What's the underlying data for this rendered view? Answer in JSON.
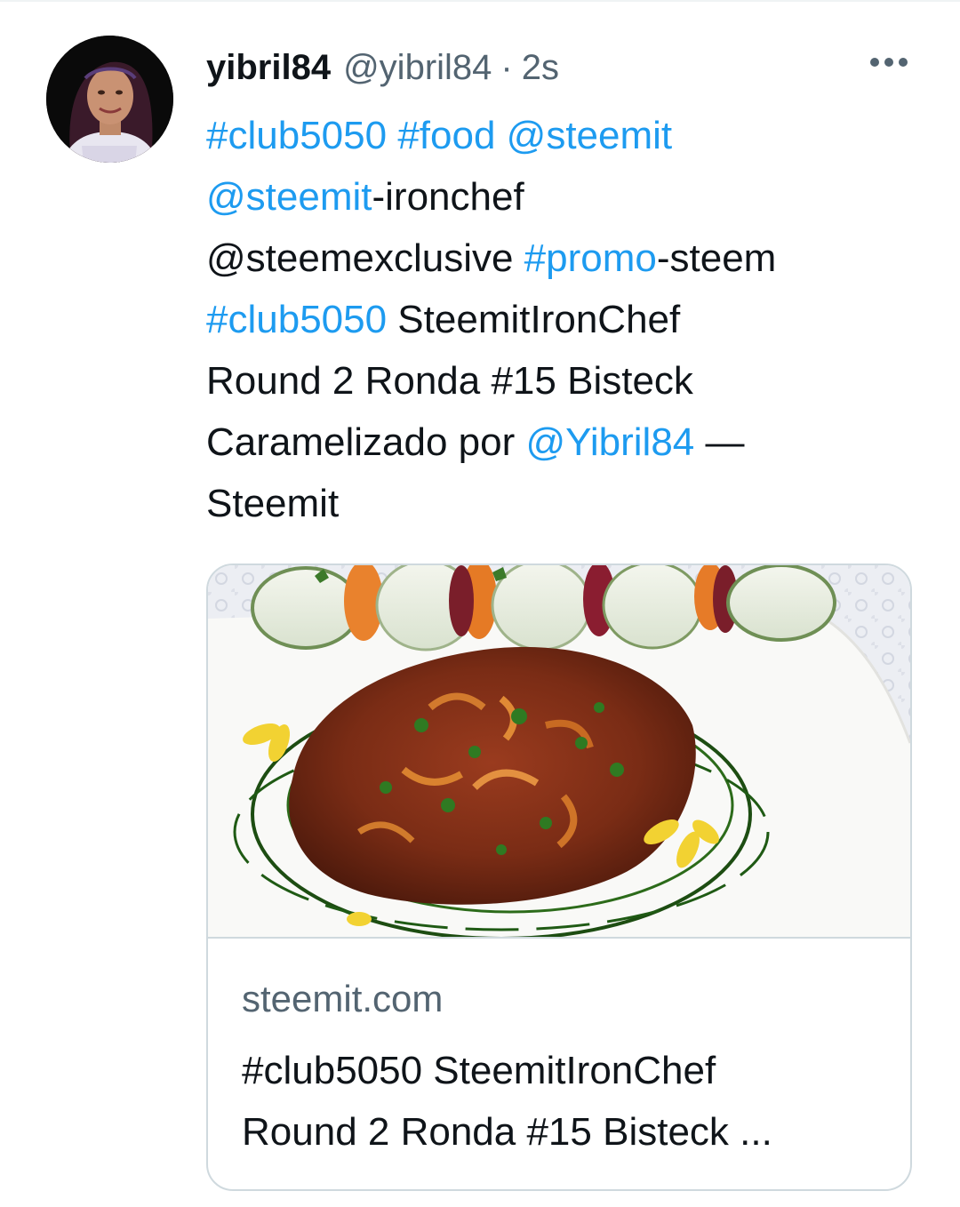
{
  "tweet": {
    "author": {
      "display_name": "yibril84",
      "handle": "@yibril84",
      "separator": "·",
      "time": "2s",
      "avatar_icon": "user-avatar"
    },
    "more_icon": "more-options-icon",
    "text_lines": [
      [
        {
          "text": "#club5050",
          "type": "hashtag"
        },
        {
          "text": " ",
          "type": "text"
        },
        {
          "text": "#food",
          "type": "hashtag"
        },
        {
          "text": " ",
          "type": "text"
        },
        {
          "text": "@steemit",
          "type": "mention"
        }
      ],
      [
        {
          "text": "@steemit",
          "type": "mention"
        },
        {
          "text": "-ironchef",
          "type": "text"
        }
      ],
      [
        {
          "text": "@steemexclusive ",
          "type": "text"
        },
        {
          "text": "#promo",
          "type": "hashtag"
        },
        {
          "text": "-steem",
          "type": "text"
        }
      ],
      [
        {
          "text": "#club5050",
          "type": "hashtag"
        },
        {
          "text": " SteemitIronChef",
          "type": "text"
        }
      ],
      [
        {
          "text": "Round 2 Ronda #15 Bisteck",
          "type": "text"
        }
      ],
      [
        {
          "text": "Caramelizado por ",
          "type": "text"
        },
        {
          "text": "@Yibril84",
          "type": "mention"
        },
        {
          "text": " —",
          "type": "text"
        }
      ],
      [
        {
          "text": "Steemit",
          "type": "text"
        }
      ]
    ],
    "link_card": {
      "domain": "steemit.com",
      "title_lines": [
        "#club5050 SteemitIronChef",
        "Round 2 Ronda #15 Bisteck ..."
      ],
      "image_icon": "steak-dish-photo"
    }
  },
  "colors": {
    "link": "#1d9bf0",
    "text": "#0f1419",
    "secondary": "#536471",
    "border": "#cfd9de"
  }
}
